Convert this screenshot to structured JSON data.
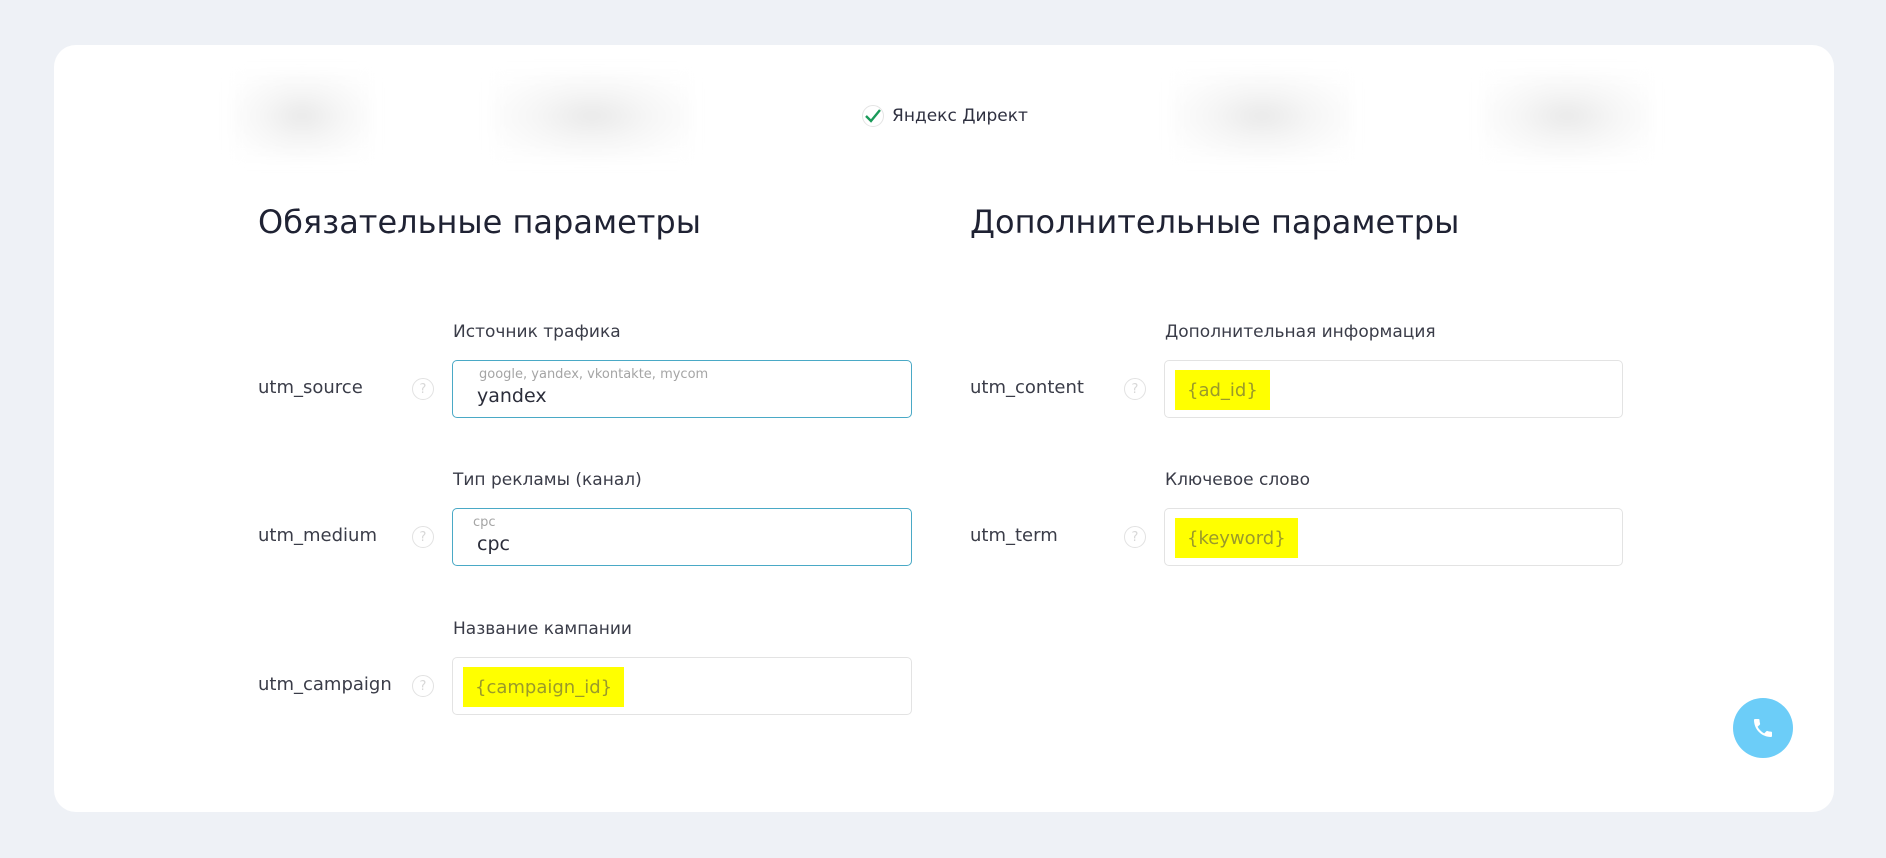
{
  "tabs": {
    "active_label": "Яндекс Директ"
  },
  "required": {
    "title": "Обязательные параметры",
    "fields": [
      {
        "param": "utm_source",
        "label": "Источник трафика",
        "placeholder": "google, yandex, vkontakte, mycom",
        "value": "yandex"
      },
      {
        "param": "utm_medium",
        "label": "Тип рекламы (канал)",
        "placeholder": "cpc",
        "value": "cpc"
      },
      {
        "param": "utm_campaign",
        "label": "Название кампании",
        "value": "{campaign_id}"
      }
    ]
  },
  "optional": {
    "title": "Дополнительные параметры",
    "fields": [
      {
        "param": "utm_content",
        "label": "Дополнительная информация",
        "value": "{ad_id}"
      },
      {
        "param": "utm_term",
        "label": "Ключевое слово",
        "value": "{keyword}"
      }
    ]
  },
  "help_symbol": "?",
  "colors": {
    "accent": "#4aa9c6",
    "highlight": "#ffff00",
    "phone": "#6ccdf8"
  }
}
